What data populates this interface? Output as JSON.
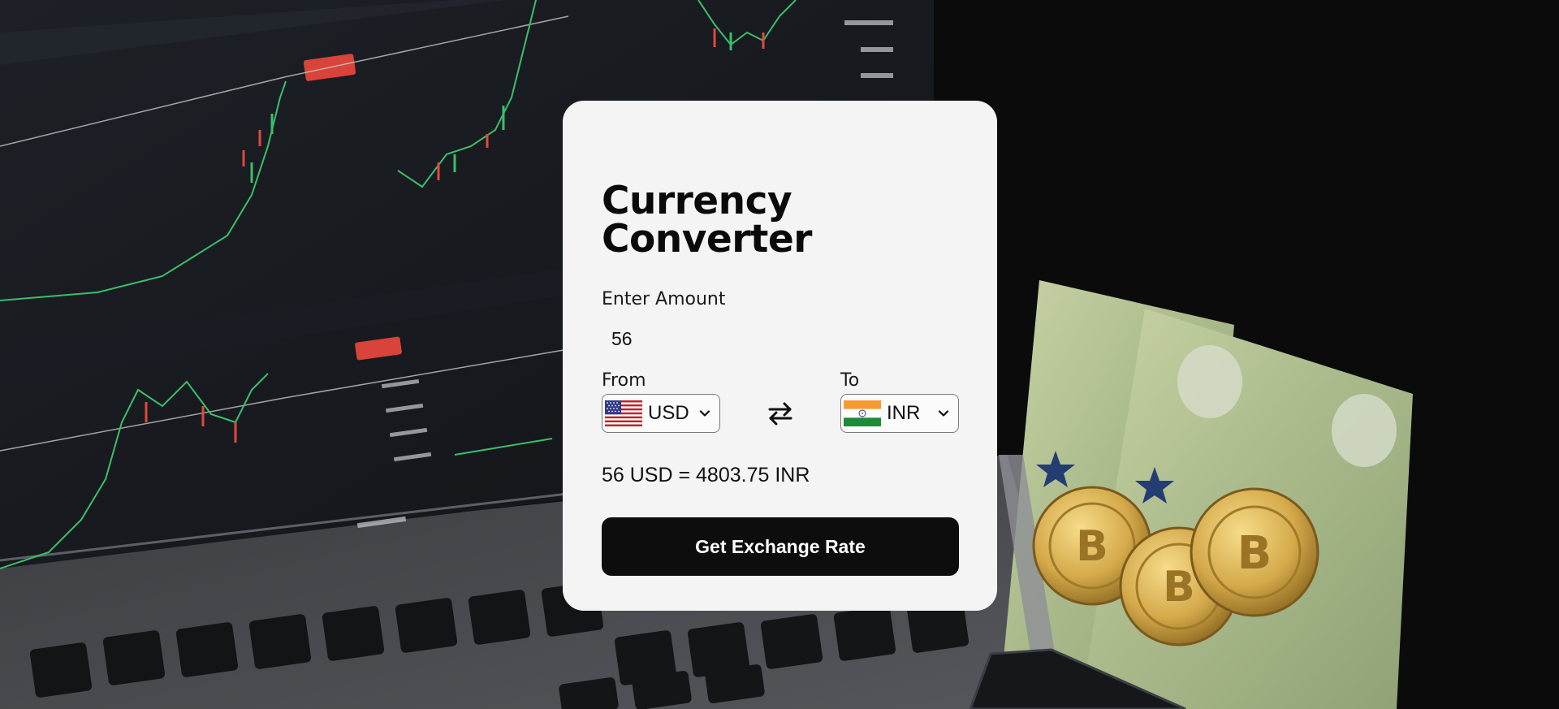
{
  "converter": {
    "title": "Currency Converter",
    "amount_label": "Enter Amount",
    "amount_value": "56",
    "from_label": "From",
    "to_label": "To",
    "from_currency": "USD",
    "to_currency": "INR",
    "result_text": "56 USD = 4803.75 INR",
    "button_label": "Get Exchange Rate"
  },
  "icons": {
    "from_flag": "us-flag-icon",
    "to_flag": "india-flag-icon",
    "dropdown": "chevron-down-icon",
    "swap": "swap-arrows-icon"
  },
  "colors": {
    "card_bg": "#f4f4f4",
    "button_bg": "#0d0d0d",
    "button_text": "#ffffff",
    "text": "#111111"
  }
}
